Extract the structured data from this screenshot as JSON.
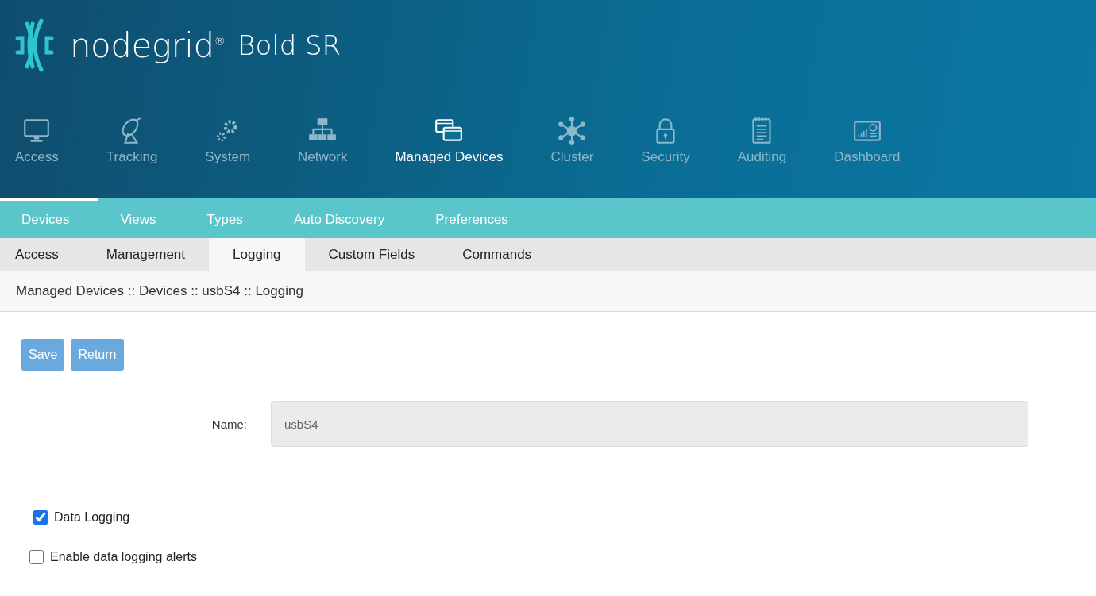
{
  "brand": {
    "name": "nodegrid$^{®}$",
    "product": "Bold SR"
  },
  "main_nav": [
    {
      "label": "Access",
      "selected": false
    },
    {
      "label": "Tracking",
      "selected": false
    },
    {
      "label": "System",
      "selected": false
    },
    {
      "label": "Network",
      "selected": false
    },
    {
      "label": "Managed Devices",
      "selected": true
    },
    {
      "label": "Cluster",
      "selected": false
    },
    {
      "label": "Security",
      "selected": false
    },
    {
      "label": "Auditing",
      "selected": false
    },
    {
      "label": "Dashboard",
      "selected": false
    }
  ],
  "sub_nav": [
    {
      "label": "Devices",
      "selected": true
    },
    {
      "label": "Views",
      "selected": false
    },
    {
      "label": "Types",
      "selected": false
    },
    {
      "label": "Auto Discovery",
      "selected": false
    },
    {
      "label": "Preferences",
      "selected": false
    }
  ],
  "tabs": [
    {
      "label": "Access",
      "selected": false
    },
    {
      "label": "Management",
      "selected": false
    },
    {
      "label": "Logging",
      "selected": true
    },
    {
      "label": "Custom Fields",
      "selected": false
    },
    {
      "label": "Commands",
      "selected": false
    }
  ],
  "breadcrumb": "Managed Devices :: Devices :: usbS4 :: Logging",
  "buttons": [
    "Save",
    "Return"
  ],
  "name_field": {
    "label": "Name:",
    "value": "usbS4"
  },
  "options": [
    {
      "label": "Data Logging",
      "checked": true
    },
    {
      "label": "Enable data logging alerts",
      "checked": false
    }
  ]
}
